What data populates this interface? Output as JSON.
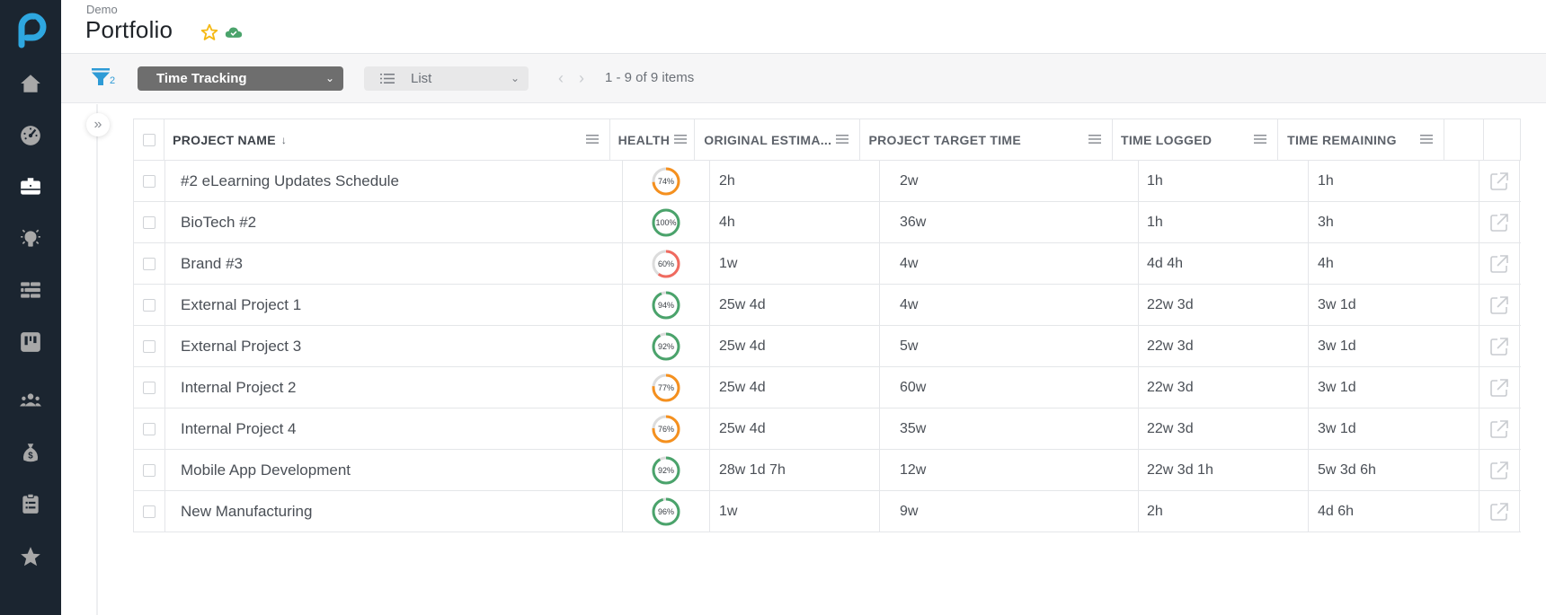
{
  "sidebar": {
    "logo": "planview-logo",
    "items": [
      {
        "name": "home",
        "icon": "home-icon",
        "active": false
      },
      {
        "name": "dashboard",
        "icon": "gauge-icon",
        "active": false
      },
      {
        "name": "portfolio",
        "icon": "briefcase-icon",
        "active": true
      },
      {
        "name": "ideas",
        "icon": "lightbulb-icon",
        "active": false
      },
      {
        "name": "grid",
        "icon": "rows-icon",
        "active": false
      },
      {
        "name": "board",
        "icon": "kanban-icon",
        "active": false
      },
      {
        "name": "people",
        "icon": "team-icon",
        "active": false
      },
      {
        "name": "budget",
        "icon": "money-bag-icon",
        "active": false
      },
      {
        "name": "tasks",
        "icon": "clipboard-icon",
        "active": false
      },
      {
        "name": "favorites",
        "icon": "star-icon",
        "active": false
      }
    ]
  },
  "header": {
    "breadcrumb": "Demo",
    "title": "Portfolio"
  },
  "toolbar": {
    "filter_count": "2",
    "view_label": "Time Tracking",
    "layout_label": "List",
    "pager_text": "1 - 9 of 9 items"
  },
  "colors": {
    "sidebar_bg": "#1b2530",
    "accent_blue": "#2e9bd6",
    "health_green": "#4aa36b",
    "health_orange": "#f5901e",
    "health_red": "#f06a5f",
    "star_yellow": "#f5b915",
    "cloud_green": "#4aa36b"
  },
  "table": {
    "columns": {
      "name": "PROJECT NAME",
      "health": "HEALTH",
      "original": "ORIGINAL ESTIMA...",
      "target": "PROJECT TARGET TIME",
      "logged": "TIME LOGGED",
      "remaining": "TIME REMAINING"
    },
    "sort_indicator": "↓",
    "rows": [
      {
        "name": "#2 eLearning Updates Schedule",
        "health": 74,
        "health_label": "74%",
        "status": "orange",
        "original": "2h",
        "target": "2w",
        "logged": "1h",
        "remaining": "1h"
      },
      {
        "name": "BioTech #2",
        "health": 100,
        "health_label": "100%",
        "status": "green",
        "original": "4h",
        "target": "36w",
        "logged": "1h",
        "remaining": "3h"
      },
      {
        "name": "Brand #3",
        "health": 60,
        "health_label": "60%",
        "status": "red",
        "original": "1w",
        "target": "4w",
        "logged": "4d 4h",
        "remaining": "4h"
      },
      {
        "name": "External Project 1",
        "health": 94,
        "health_label": "94%",
        "status": "green",
        "original": "25w 4d",
        "target": "4w",
        "logged": "22w 3d",
        "remaining": "3w 1d"
      },
      {
        "name": "External Project 3",
        "health": 92,
        "health_label": "92%",
        "status": "green",
        "original": "25w 4d",
        "target": "5w",
        "logged": "22w 3d",
        "remaining": "3w 1d"
      },
      {
        "name": "Internal Project 2",
        "health": 77,
        "health_label": "77%",
        "status": "orange",
        "original": "25w 4d",
        "target": "60w",
        "logged": "22w 3d",
        "remaining": "3w 1d"
      },
      {
        "name": "Internal Project 4",
        "health": 76,
        "health_label": "76%",
        "status": "orange",
        "original": "25w 4d",
        "target": "35w",
        "logged": "22w 3d",
        "remaining": "3w 1d"
      },
      {
        "name": "Mobile App Development",
        "health": 92,
        "health_label": "92%",
        "status": "green",
        "original": "28w 1d 7h",
        "target": "12w",
        "logged": "22w 3d 1h",
        "remaining": "5w 3d 6h"
      },
      {
        "name": "New Manufacturing",
        "health": 96,
        "health_label": "96%",
        "status": "green",
        "original": "1w",
        "target": "9w",
        "logged": "2h",
        "remaining": "4d 6h"
      }
    ]
  }
}
